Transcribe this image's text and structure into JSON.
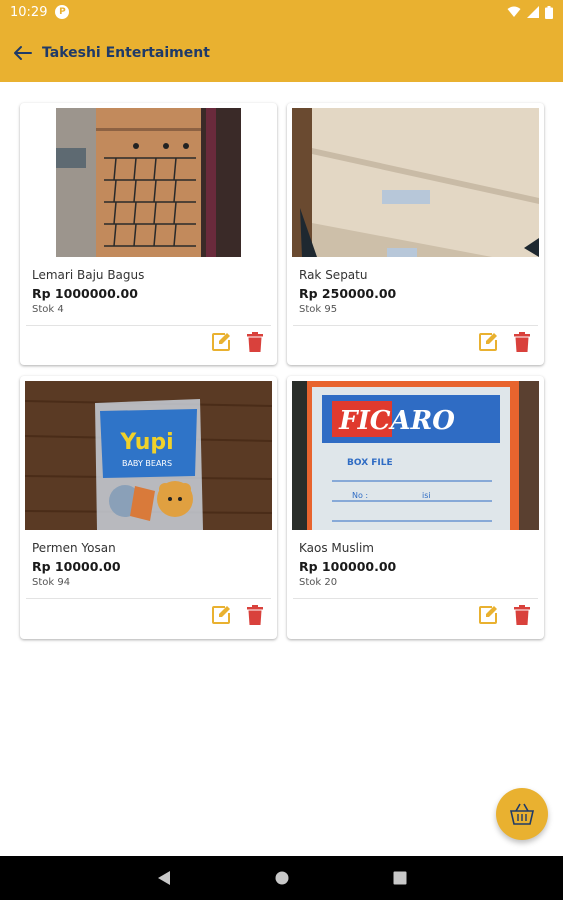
{
  "status_bar": {
    "time": "10:29",
    "notification_icon": "p-badge-icon"
  },
  "app_bar": {
    "title": "Takeshi Entertaiment"
  },
  "colors": {
    "primary": "#e9b130",
    "title": "#1f3a68",
    "edit": "#e9b130",
    "delete": "#d9413c"
  },
  "products": [
    {
      "name": "Lemari Baju Bagus",
      "price": "Rp 1000000.00",
      "stock": "Stok 4"
    },
    {
      "name": "Rak Sepatu",
      "price": "Rp 250000.00",
      "stock": "Stok 95"
    },
    {
      "name": "Permen Yosan",
      "price": "Rp 10000.00",
      "stock": "Stok 94"
    },
    {
      "name": "Kaos Muslim",
      "price": "Rp 100000.00",
      "stock": "Stok 20"
    }
  ],
  "images": {
    "candy_brand": "Yupi",
    "candy_sub": "BABY BEARS",
    "box_brand": "FICARO",
    "box_label": "BOX FILE",
    "box_no": "No :",
    "box_isi": "isi"
  }
}
